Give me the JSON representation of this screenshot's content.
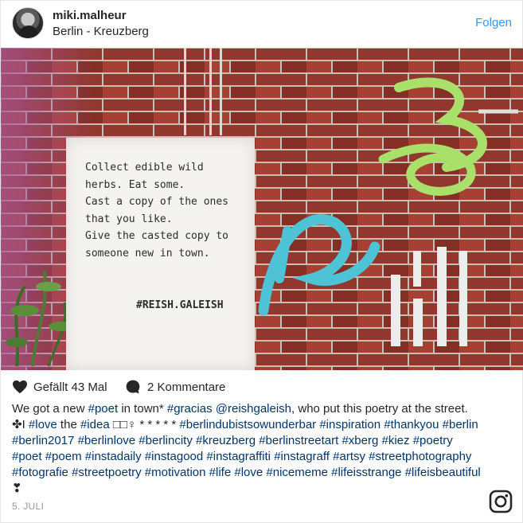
{
  "header": {
    "username": "miki.malheur",
    "location": "Berlin - Kreuzberg",
    "follow_label": "Folgen"
  },
  "poster": {
    "text": "Collect edible wild\nherbs. Eat some.\nCast a copy of the ones\nthat you like.\nGive the casted copy to\nsomeone new in town.",
    "tag": "#REISH.GALEISH"
  },
  "actions": {
    "likes": "Gefällt 43 Mal",
    "comments": "2 Kommentare"
  },
  "caption": {
    "intro": "We got a new ",
    "line1_rest": " in town* ",
    "segments": [
      {
        "t": "We got a new ",
        "tag": false
      },
      {
        "t": "#poet",
        "tag": true
      },
      {
        "t": " in town* ",
        "tag": false
      },
      {
        "t": "#gracias",
        "tag": true
      },
      {
        "t": " ",
        "tag": false
      },
      {
        "t": "@reishgaleish",
        "tag": true
      },
      {
        "t": ", who put this poetry at the street. ✤I ",
        "tag": false
      },
      {
        "t": "#love",
        "tag": true
      },
      {
        "t": " the ",
        "tag": false
      },
      {
        "t": "#idea",
        "tag": true
      },
      {
        "t": " □□♀ * * * * * ",
        "tag": false
      },
      {
        "t": "#berlindubistsowunderbar",
        "tag": true
      },
      {
        "t": " ",
        "tag": false
      },
      {
        "t": "#inspiration",
        "tag": true
      },
      {
        "t": " ",
        "tag": false
      },
      {
        "t": "#thankyou",
        "tag": true
      },
      {
        "t": " ",
        "tag": false
      },
      {
        "t": "#berlin",
        "tag": true
      },
      {
        "t": " ",
        "tag": false
      },
      {
        "t": "#berlin2017",
        "tag": true
      },
      {
        "t": " ",
        "tag": false
      },
      {
        "t": "#berlinlove",
        "tag": true
      },
      {
        "t": " ",
        "tag": false
      },
      {
        "t": "#berlincity",
        "tag": true
      },
      {
        "t": " ",
        "tag": false
      },
      {
        "t": "#kreuzberg",
        "tag": true
      },
      {
        "t": " ",
        "tag": false
      },
      {
        "t": "#berlinstreetart",
        "tag": true
      },
      {
        "t": " ",
        "tag": false
      },
      {
        "t": "#xberg",
        "tag": true
      },
      {
        "t": " ",
        "tag": false
      },
      {
        "t": "#kiez",
        "tag": true
      },
      {
        "t": " ",
        "tag": false
      },
      {
        "t": "#poetry",
        "tag": true
      },
      {
        "t": " ",
        "tag": false
      },
      {
        "t": "#poet",
        "tag": true
      },
      {
        "t": " ",
        "tag": false
      },
      {
        "t": "#poem",
        "tag": true
      },
      {
        "t": " ",
        "tag": false
      },
      {
        "t": "#instadaily",
        "tag": true
      },
      {
        "t": " ",
        "tag": false
      },
      {
        "t": "#instagood",
        "tag": true
      },
      {
        "t": " ",
        "tag": false
      },
      {
        "t": "#instagraffiti",
        "tag": true
      },
      {
        "t": " ",
        "tag": false
      },
      {
        "t": "#instagraff",
        "tag": true
      },
      {
        "t": " ",
        "tag": false
      },
      {
        "t": "#artsy",
        "tag": true
      },
      {
        "t": " ",
        "tag": false
      },
      {
        "t": "#streetphotography",
        "tag": true
      },
      {
        "t": " ",
        "tag": false
      },
      {
        "t": "#fotografie",
        "tag": true
      },
      {
        "t": " ",
        "tag": false
      },
      {
        "t": "#streetpoetry",
        "tag": true
      },
      {
        "t": " ",
        "tag": false
      },
      {
        "t": "#motivation",
        "tag": true
      },
      {
        "t": " ",
        "tag": false
      },
      {
        "t": "#life",
        "tag": true
      },
      {
        "t": " ",
        "tag": false
      },
      {
        "t": "#love",
        "tag": true
      },
      {
        "t": " ",
        "tag": false
      },
      {
        "t": "#nicememe",
        "tag": true
      },
      {
        "t": " ",
        "tag": false
      },
      {
        "t": "#lifeisstrange",
        "tag": true
      },
      {
        "t": " ",
        "tag": false
      },
      {
        "t": "#lifeisbeautiful",
        "tag": true
      },
      {
        "t": " ❣",
        "tag": false
      }
    ]
  },
  "date": "5. JULI",
  "icons": {
    "avatar": "avatar",
    "like": "heart-icon",
    "comment": "comment-icon",
    "brand": "instagram-icon"
  },
  "colors": {
    "link": "#3897f0",
    "hashtag": "#003569",
    "text": "#262626",
    "muted": "#999999"
  }
}
